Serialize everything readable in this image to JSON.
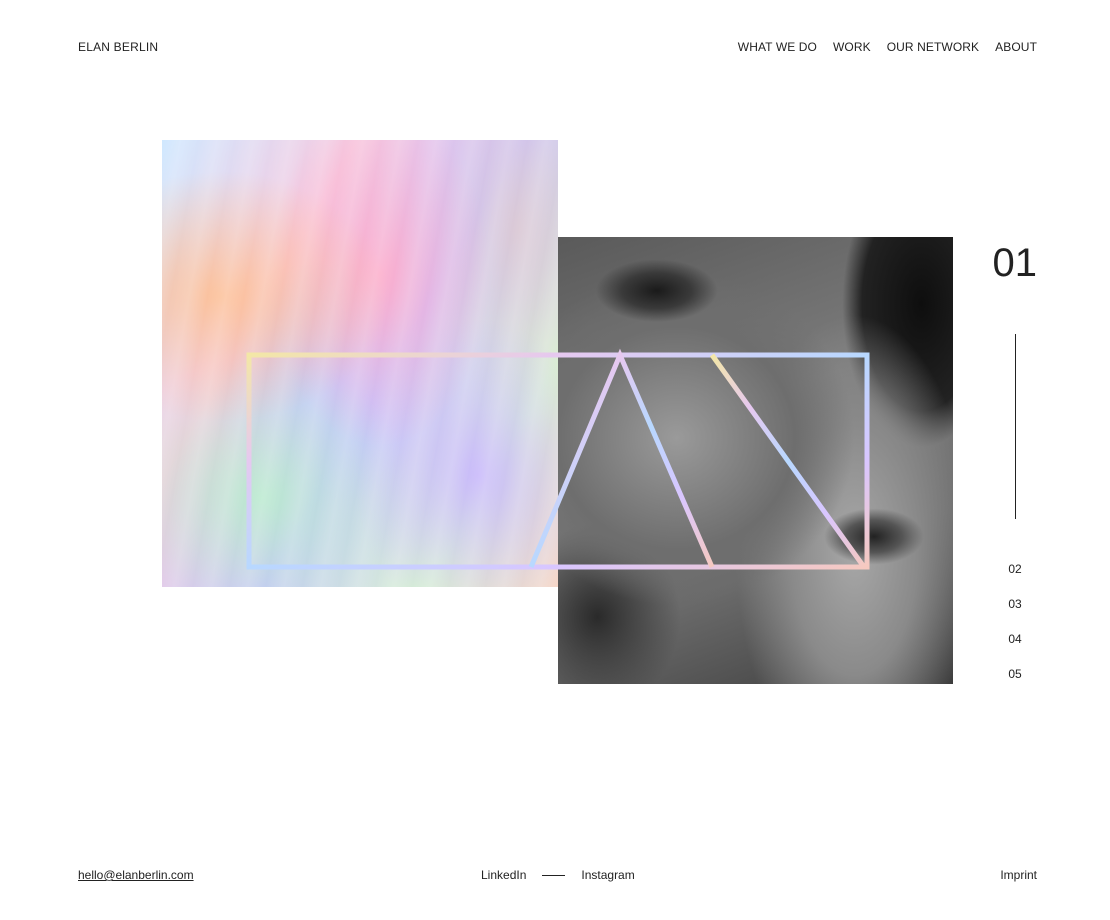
{
  "header": {
    "brand": "ELAN BERLIN",
    "nav": [
      "WHAT WE DO",
      "WORK",
      "OUR NETWORK",
      "ABOUT"
    ]
  },
  "slider": {
    "current": "01",
    "others": [
      "02",
      "03",
      "04",
      "05"
    ]
  },
  "footer": {
    "email": "hello@elanberlin.com",
    "social": [
      "LinkedIn",
      "Instagram"
    ],
    "imprint": "Imprint"
  }
}
